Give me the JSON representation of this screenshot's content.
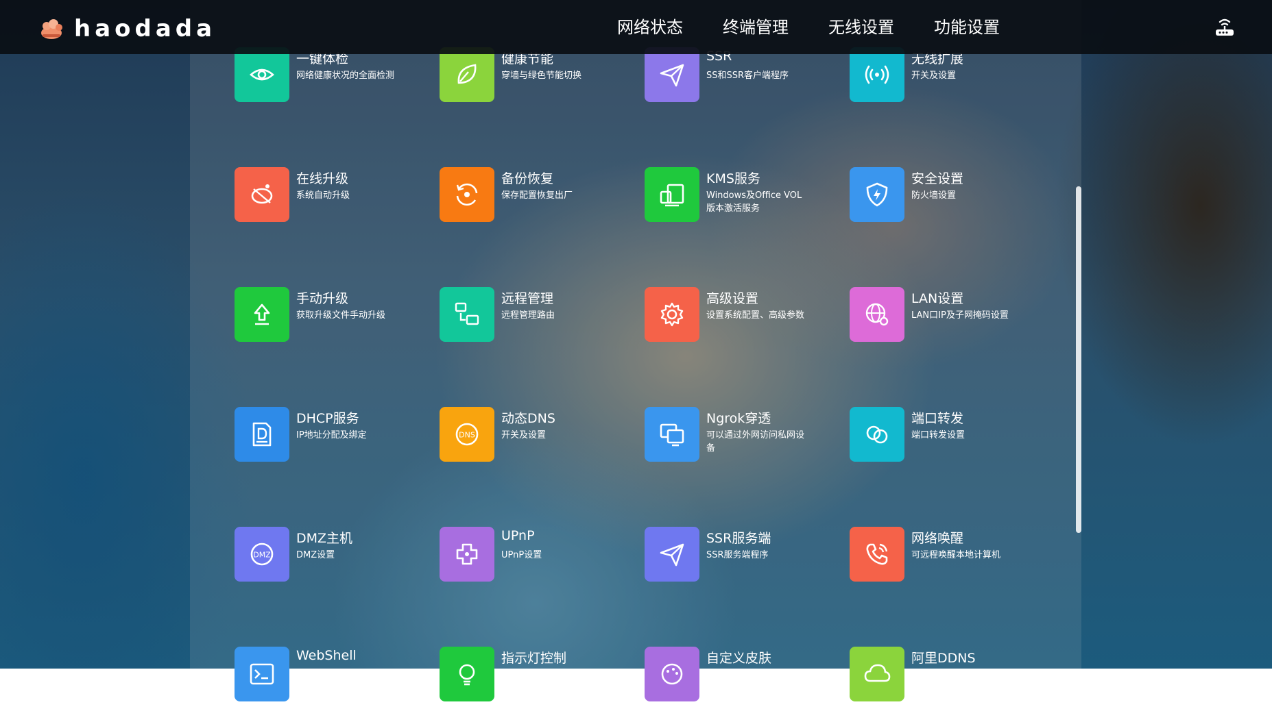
{
  "brand": {
    "name": "haodada"
  },
  "nav": [
    {
      "label": "网络状态"
    },
    {
      "label": "终端管理"
    },
    {
      "label": "无线设置"
    },
    {
      "label": "功能设置"
    }
  ],
  "tiles": [
    {
      "title": "一键体检",
      "desc": "网络健康状况的全面检测",
      "color": "#12c79a",
      "icon": "eye-icon"
    },
    {
      "title": "健康节能",
      "desc": "穿墙与绿色节能切换",
      "color": "#8bd43c",
      "icon": "leaf-icon"
    },
    {
      "title": "SSR",
      "desc": "SS和SSR客户端程序",
      "color": "#8c78ea",
      "icon": "paper-plane-icon"
    },
    {
      "title": "无线扩展",
      "desc": "开关及设置",
      "color": "#12b9cf",
      "icon": "wireless-signal-icon"
    },
    {
      "title": "在线升级",
      "desc": "系统自动升级",
      "color": "#f56249",
      "icon": "satellite-icon"
    },
    {
      "title": "备份恢复",
      "desc": "保存配置恢复出厂",
      "color": "#f87a12",
      "icon": "backup-restore-icon"
    },
    {
      "title": "KMS服务",
      "desc": "Windows及Office VOL版本激活服务",
      "color": "#1fc93d",
      "icon": "computer-devices-icon"
    },
    {
      "title": "安全设置",
      "desc": "防火墙设置",
      "color": "#3a96ee",
      "icon": "shield-icon"
    },
    {
      "title": "手动升级",
      "desc": "获取升级文件手动升级",
      "color": "#1fc93d",
      "icon": "upload-icon"
    },
    {
      "title": "远程管理",
      "desc": "远程管理路由",
      "color": "#12c79a",
      "icon": "remote-network-icon"
    },
    {
      "title": "高级设置",
      "desc": "设置系统配置、高级参数",
      "color": "#f56249",
      "icon": "gear-icon"
    },
    {
      "title": "LAN设置",
      "desc": "LAN口IP及子网掩码设置",
      "color": "#dd6bd8",
      "icon": "globe-gear-icon"
    },
    {
      "title": "DHCP服务",
      "desc": "IP地址分配及绑定",
      "color": "#2e8be8",
      "icon": "dhcp-document-icon"
    },
    {
      "title": "动态DNS",
      "desc": "开关及设置",
      "color": "#f9a40e",
      "icon": "dns-icon"
    },
    {
      "title": "Ngrok穿透",
      "desc": "可以通过外网访问私网设备",
      "color": "#3a96ee",
      "icon": "monitors-icon"
    },
    {
      "title": "端口转发",
      "desc": "端口转发设置",
      "color": "#12b9cf",
      "icon": "linked-circles-icon"
    },
    {
      "title": "DMZ主机",
      "desc": "DMZ设置",
      "color": "#6f78f0",
      "icon": "dmz-icon"
    },
    {
      "title": "UPnP",
      "desc": "UPnP设置",
      "color": "#a86ee0",
      "icon": "puzzle-icon"
    },
    {
      "title": "SSR服务端",
      "desc": "SSR服务端程序",
      "color": "#6f78f0",
      "icon": "paper-plane-icon"
    },
    {
      "title": "网络唤醒",
      "desc": "可远程唤醒本地计算机",
      "color": "#f56249",
      "icon": "phone-call-icon"
    },
    {
      "title": "WebShell",
      "desc": "",
      "color": "#3a96ee",
      "icon": "terminal-icon"
    },
    {
      "title": "指示灯控制",
      "desc": "",
      "color": "#1fc93d",
      "icon": "light-icon"
    },
    {
      "title": "自定义皮肤",
      "desc": "",
      "color": "#a86ee0",
      "icon": "skin-icon"
    },
    {
      "title": "阿里DDNS",
      "desc": "",
      "color": "#8bd43c",
      "icon": "cloud-dns-icon"
    }
  ]
}
